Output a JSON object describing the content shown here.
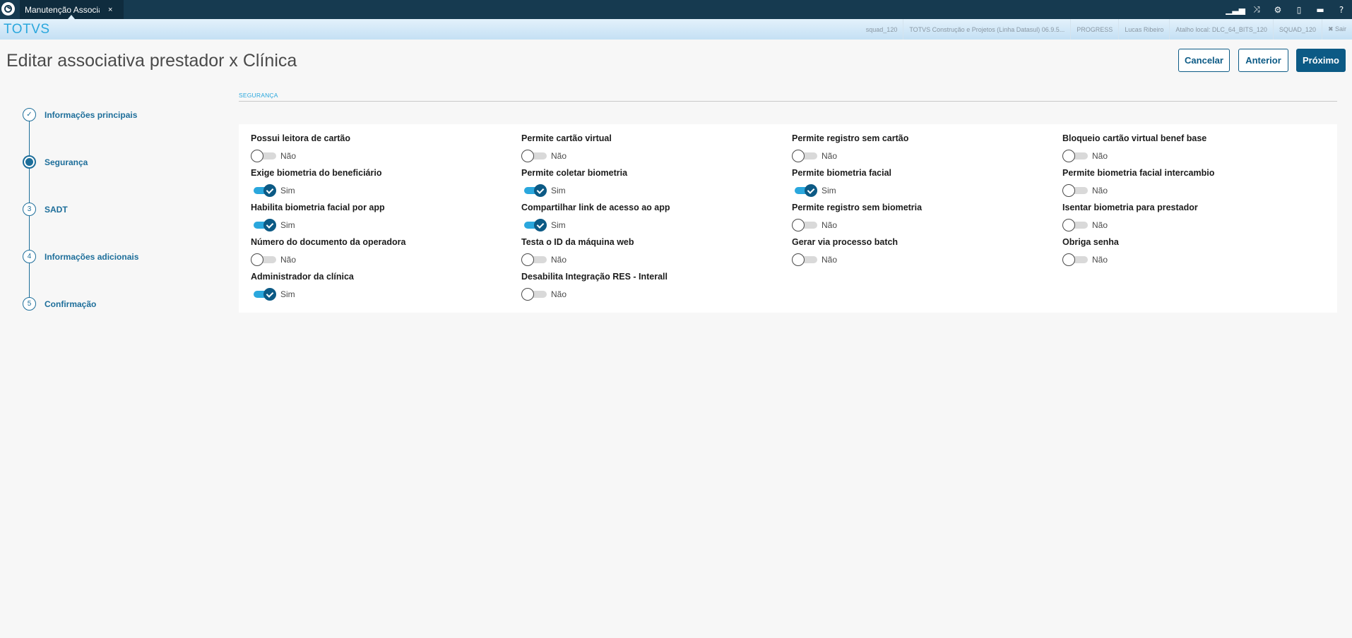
{
  "window": {
    "tab_label": "Manutenção Associati",
    "tab_close": "×"
  },
  "topbar_icons": [
    "signal-icon",
    "shuffle-icon",
    "gear-icon",
    "document-icon",
    "chat-icon",
    "help-icon"
  ],
  "topbar_icon_glyphs": [
    "▁▃▅",
    "⤨",
    "⚙",
    "▯",
    "▬",
    "?"
  ],
  "brand": "TOTVS",
  "infobar": [
    "squad_120",
    "TOTVS Construção e Projetos (Linha Datasul) 06.9.5...",
    "PROGRESS",
    "Lucas Ribeiro",
    "Atalho local: DLC_64_BITS_120",
    "SQUAD_120",
    "✖ Sair"
  ],
  "header": {
    "title": "Editar associativa prestador x Clínica",
    "cancel": "Cancelar",
    "previous": "Anterior",
    "next": "Próximo"
  },
  "stepper": [
    {
      "marker": "✓",
      "label": "Informações principais",
      "state": "done"
    },
    {
      "marker": "",
      "label": "Segurança",
      "state": "active"
    },
    {
      "marker": "3",
      "label": "SADT",
      "state": "pending"
    },
    {
      "marker": "4",
      "label": "Informações adicionais",
      "state": "pending"
    },
    {
      "marker": "5",
      "label": "Confirmação",
      "state": "pending"
    }
  ],
  "section": {
    "title": "SEGURANÇA"
  },
  "fields": [
    {
      "label": "Possui leitora de cartão",
      "value": "Não",
      "on": false
    },
    {
      "label": "Permite cartão virtual",
      "value": "Não",
      "on": false
    },
    {
      "label": "Permite registro sem cartão",
      "value": "Não",
      "on": false
    },
    {
      "label": "Bloqueio cartão virtual benef base",
      "value": "Não",
      "on": false
    },
    {
      "label": "Exige biometria do beneficiário",
      "value": "Sim",
      "on": true
    },
    {
      "label": "Permite coletar biometria",
      "value": "Sim",
      "on": true
    },
    {
      "label": "Permite biometria facial",
      "value": "Sim",
      "on": true
    },
    {
      "label": "Permite biometria facial intercambio",
      "value": "Não",
      "on": false
    },
    {
      "label": "Habilita biometria facial por app",
      "value": "Sim",
      "on": true
    },
    {
      "label": "Compartilhar link de acesso ao app",
      "value": "Sim",
      "on": true
    },
    {
      "label": "Permite registro sem biometria",
      "value": "Não",
      "on": false
    },
    {
      "label": "Isentar biometria para prestador",
      "value": "Não",
      "on": false
    },
    {
      "label": "Número do documento da operadora",
      "value": "Não",
      "on": false
    },
    {
      "label": "Testa o ID da máquina web",
      "value": "Não",
      "on": false
    },
    {
      "label": "Gerar via processo batch",
      "value": "Não",
      "on": false
    },
    {
      "label": "Obriga senha",
      "value": "Não",
      "on": false
    },
    {
      "label": "Administrador da clínica",
      "value": "Sim",
      "on": true
    },
    {
      "label": "Desabilita Integração RES - Interall",
      "value": "Não",
      "on": false
    }
  ]
}
